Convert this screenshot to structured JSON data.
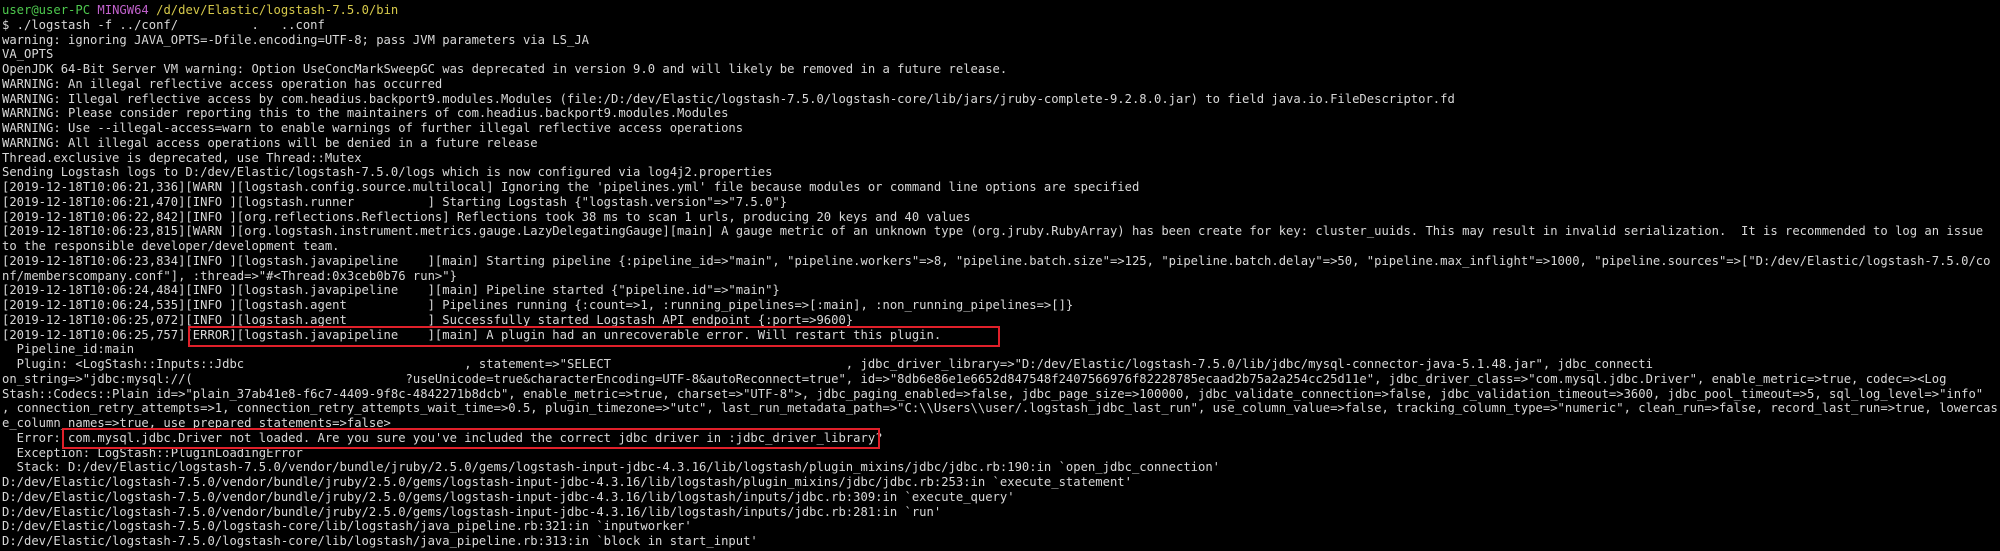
{
  "prompt": {
    "user_host": "user@user-PC",
    "shell": "MINGW64",
    "path": "/d/dev/Elastic/logstash-7.5.0/bin"
  },
  "colors": {
    "background": "#000000",
    "text": "#d8d8d8",
    "prompt_user": "#4ec94e",
    "prompt_shell": "#c061cb",
    "prompt_path": "#d6c94a",
    "highlight_box": "#e0202a"
  },
  "lines": [
    "$ ./logstash -f ../conf/          .   ..conf",
    "warning: ignoring JAVA_OPTS=-Dfile.encoding=UTF-8; pass JVM parameters via LS_JA",
    "VA_OPTS",
    "OpenJDK 64-Bit Server VM warning: Option UseConcMarkSweepGC was deprecated in version 9.0 and will likely be removed in a future release.",
    "WARNING: An illegal reflective access operation has occurred",
    "WARNING: Illegal reflective access by com.headius.backport9.modules.Modules (file:/D:/dev/Elastic/logstash-7.5.0/logstash-core/lib/jars/jruby-complete-9.2.8.0.jar) to field java.io.FileDescriptor.fd",
    "WARNING: Please consider reporting this to the maintainers of com.headius.backport9.modules.Modules",
    "WARNING: Use --illegal-access=warn to enable warnings of further illegal reflective access operations",
    "WARNING: All illegal access operations will be denied in a future release",
    "Thread.exclusive is deprecated, use Thread::Mutex",
    "Sending Logstash logs to D:/dev/Elastic/logstash-7.5.0/logs which is now configured via log4j2.properties",
    "[2019-12-18T10:06:21,336][WARN ][logstash.config.source.multilocal] Ignoring the 'pipelines.yml' file because modules or command line options are specified",
    "[2019-12-18T10:06:21,470][INFO ][logstash.runner          ] Starting Logstash {\"logstash.version\"=>\"7.5.0\"}",
    "[2019-12-18T10:06:22,842][INFO ][org.reflections.Reflections] Reflections took 38 ms to scan 1 urls, producing 20 keys and 40 values",
    "[2019-12-18T10:06:23,815][WARN ][org.logstash.instrument.metrics.gauge.LazyDelegatingGauge][main] A gauge metric of an unknown type (org.jruby.RubyArray) has been create for key: cluster_uuids. This may result in invalid serialization.  It is recommended to log an issue",
    "to the responsible developer/development team.",
    "[2019-12-18T10:06:23,834][INFO ][logstash.javapipeline    ][main] Starting pipeline {:pipeline_id=>\"main\", \"pipeline.workers\"=>8, \"pipeline.batch.size\"=>125, \"pipeline.batch.delay\"=>50, \"pipeline.max_inflight\"=>1000, \"pipeline.sources\"=>[\"D:/dev/Elastic/logstash-7.5.0/co",
    "nf/memberscompany.conf\"], :thread=>\"#<Thread:0x3ceb0b76 run>\"}",
    "[2019-12-18T10:06:24,484][INFO ][logstash.javapipeline    ][main] Pipeline started {\"pipeline.id\"=>\"main\"}",
    "[2019-12-18T10:06:24,535][INFO ][logstash.agent           ] Pipelines running {:count=>1, :running_pipelines=>[:main], :non_running_pipelines=>[]}",
    "[2019-12-18T10:06:25,072][INFO ][logstash.agent           ] Successfully started Logstash API endpoint {:port=>9600}",
    "[2019-12-18T10:06:25,757][ERROR][logstash.javapipeline    ][main] A plugin had an unrecoverable error. Will restart this plugin.",
    "  Pipeline_id:main",
    "  Plugin: <LogStash::Inputs::Jdbc                              , statement=>\"SELECT                                , jdbc_driver_library=>\"D:/dev/Elastic/logstash-7.5.0/lib/jdbc/mysql-connector-java-5.1.48.jar\", jdbc_connecti",
    "on_string=>\"jdbc:mysql://(                             ?useUnicode=true&characterEncoding=UTF-8&autoReconnect=true\", id=>\"8db6e86e1e6652d847548f2407566976f82228785ecaad2b75a2a254cc25d11e\", jdbc_driver_class=>\"com.mysql.jdbc.Driver\", enable_metric=>true, codec=><Log",
    "Stash::Codecs::Plain id=>\"plain_37ab41e8-f6c7-4409-9f8c-4842271b8dcb\", enable_metric=>true, charset=>\"UTF-8\">, jdbc_paging_enabled=>false, jdbc_page_size=>100000, jdbc_validate_connection=>false, jdbc_validation_timeout=>3600, jdbc_pool_timeout=>5, sql_log_level=>\"info\"",
    ", connection_retry_attempts=>1, connection_retry_attempts_wait_time=>0.5, plugin_timezone=>\"utc\", last_run_metadata_path=>\"C:\\\\Users\\\\user/.logstash_jdbc_last_run\", use_column_value=>false, tracking_column_type=>\"numeric\", clean_run=>false, record_last_run=>true, lowercas",
    "e_column_names=>true, use_prepared_statements=>false>",
    "  Error: com.mysql.jdbc.Driver not loaded. Are you sure you've included the correct jdbc driver in :jdbc_driver_library?",
    "  Exception: LogStash::PluginLoadingError",
    "  Stack: D:/dev/Elastic/logstash-7.5.0/vendor/bundle/jruby/2.5.0/gems/logstash-input-jdbc-4.3.16/lib/logstash/plugin_mixins/jdbc/jdbc.rb:190:in `open_jdbc_connection'",
    "D:/dev/Elastic/logstash-7.5.0/vendor/bundle/jruby/2.5.0/gems/logstash-input-jdbc-4.3.16/lib/logstash/plugin_mixins/jdbc/jdbc.rb:253:in `execute_statement'",
    "D:/dev/Elastic/logstash-7.5.0/vendor/bundle/jruby/2.5.0/gems/logstash-input-jdbc-4.3.16/lib/logstash/inputs/jdbc.rb:309:in `execute_query'",
    "D:/dev/Elastic/logstash-7.5.0/vendor/bundle/jruby/2.5.0/gems/logstash-input-jdbc-4.3.16/lib/logstash/inputs/jdbc.rb:281:in `run'",
    "D:/dev/Elastic/logstash-7.5.0/logstash-core/lib/logstash/java_pipeline.rb:321:in `inputworker'",
    "D:/dev/Elastic/logstash-7.5.0/logstash-core/lib/logstash/java_pipeline.rb:313:in `block in start_input'"
  ]
}
